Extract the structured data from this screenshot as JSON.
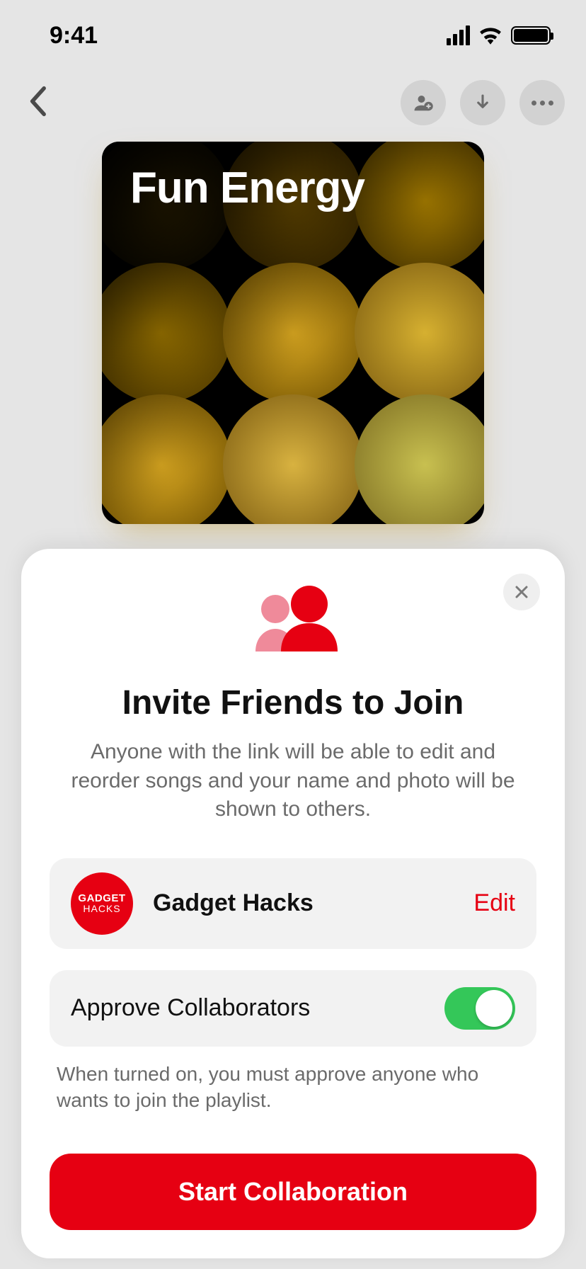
{
  "status": {
    "time": "9:41"
  },
  "playlist": {
    "title": "Fun Energy"
  },
  "sheet": {
    "title": "Invite Friends to Join",
    "description": "Anyone with the link will be able to edit and reorder songs and your name and photo will be shown to others.",
    "profile": {
      "name": "Gadget Hacks",
      "avatar_line1": "GADGET",
      "avatar_line2": "HACKS",
      "edit_label": "Edit"
    },
    "approve": {
      "label": "Approve Collaborators",
      "enabled": true,
      "help": "When turned on, you must approve anyone who wants to join the playlist."
    },
    "cta_label": "Start Collaboration"
  }
}
